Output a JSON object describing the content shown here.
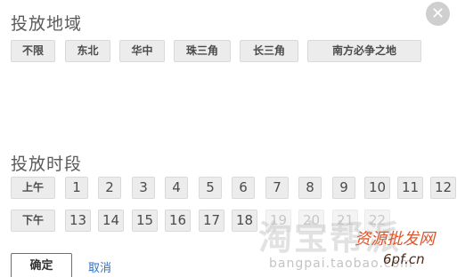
{
  "dialog": {
    "close_symbol": "✕"
  },
  "region_section": {
    "title": "投放地域",
    "options": [
      "不限",
      "东北",
      "华中",
      "珠三角",
      "长三角",
      "南方必争之地"
    ]
  },
  "time_section": {
    "title": "投放时段",
    "morning_label": "上午",
    "afternoon_label": "下午",
    "morning_hours": [
      "1",
      "2",
      "3",
      "4",
      "5",
      "6",
      "7",
      "8",
      "9",
      "10",
      "11",
      "12"
    ],
    "afternoon_hours": [
      "13",
      "14",
      "15",
      "16",
      "17",
      "18",
      "19",
      "20",
      "21",
      "22"
    ]
  },
  "footer": {
    "confirm_label": "确定",
    "cancel_label": "取消"
  },
  "watermark": {
    "logo_text": "淘宝帮派",
    "url_text": "bangpai.taobao.com",
    "site_text": "资源批发网",
    "domain_text": "6pf.cn"
  },
  "colors": {
    "chip_background": "#ececec",
    "cancel_link": "#2f72c4",
    "close_button": "#cfcfcf"
  },
  "icons": {
    "close": "close-icon"
  }
}
